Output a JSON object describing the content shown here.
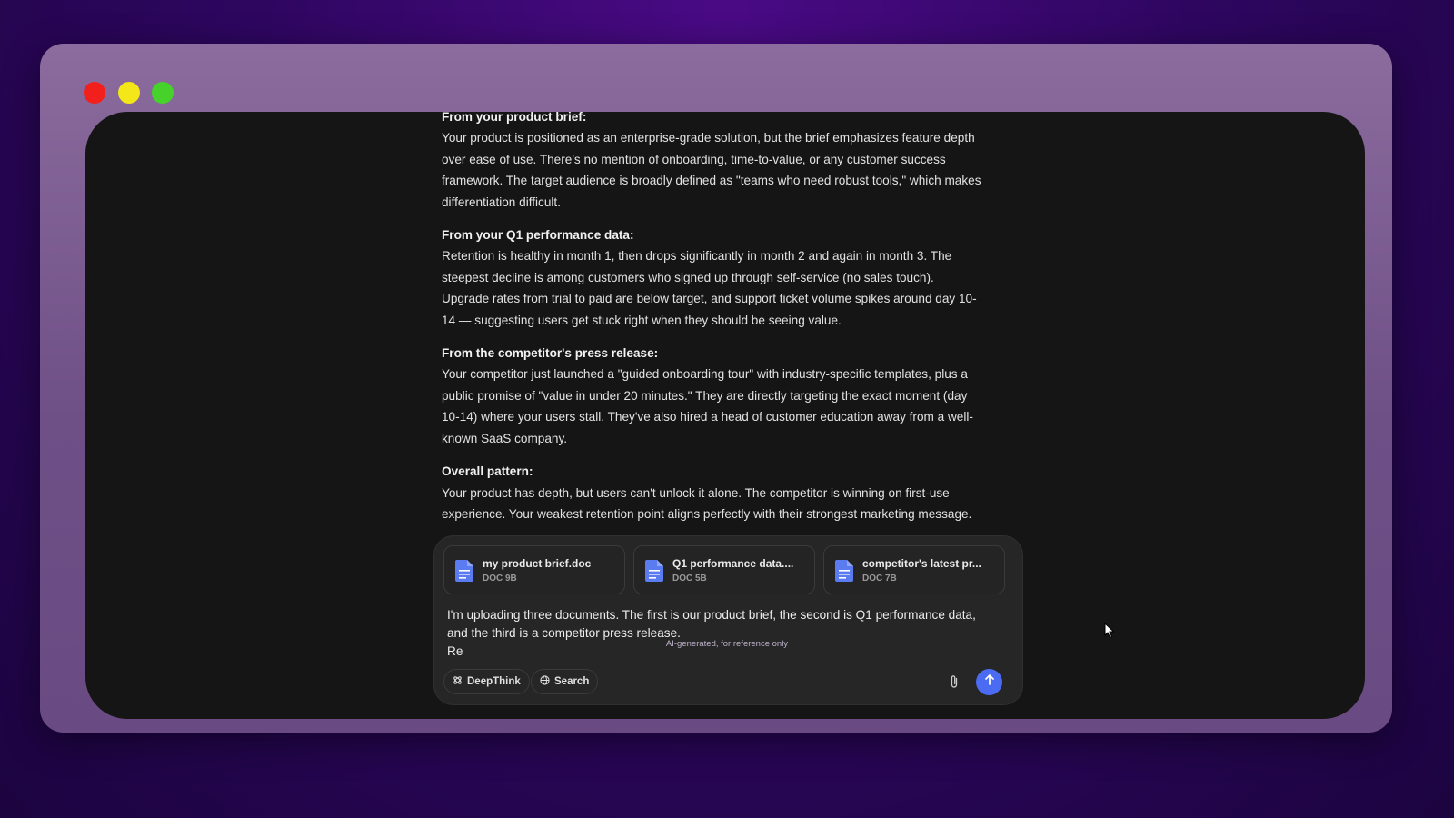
{
  "window": {
    "traffic_lights": [
      "close",
      "minimize",
      "maximize"
    ],
    "colors": {
      "close": "#f2201c",
      "minimize": "#f3e71a",
      "maximize": "#46d12b"
    }
  },
  "chat": {
    "sections": [
      {
        "title": "From your product brief:",
        "lines": [
          "Your product is positioned as an enterprise-grade solution, but the brief emphasizes feature depth",
          "over ease of use. There's no mention of onboarding, time-to-value, or any customer success",
          "framework. The target audience is broadly defined as \"teams who need robust tools,\" which makes",
          "differentiation difficult."
        ]
      },
      {
        "title": "From your Q1 performance data:",
        "lines": [
          "Retention is healthy in month 1, then drops significantly in month 2 and again in month 3. The",
          "steepest decline is among customers who signed up through self-service (no sales touch).",
          "Upgrade rates from trial to paid are below target, and support ticket volume spikes around day 10-",
          "14 — suggesting users get stuck right when they should be seeing value."
        ]
      },
      {
        "title": "From the competitor's press release:",
        "lines": [
          "Your competitor just launched a \"guided onboarding tour\" with industry-specific templates, plus a",
          "public promise of \"value in under 20 minutes.\" They are directly targeting the exact moment (day",
          "10-14) where your users stall. They've also hired a head of customer education away from a well-",
          "known SaaS company."
        ]
      },
      {
        "title": "Overall pattern:",
        "lines": [
          "Your product has depth, but users can't unlock it alone. The competitor is winning on first-use",
          "experience. Your weakest retention point aligns perfectly with their strongest marketing message."
        ]
      }
    ]
  },
  "composer": {
    "files": [
      {
        "name": "my product brief.doc",
        "meta": "DOC 9B"
      },
      {
        "name": "Q1 performance data....",
        "meta": "DOC 5B"
      },
      {
        "name": "competitor's latest pr...",
        "meta": "DOC 7B"
      }
    ],
    "message_lines": [
      "I'm uploading three documents. The first is our product brief, the second is Q1 performance data,",
      "and the third is a competitor press release.",
      "Re"
    ],
    "deepthink_label": "DeepThink",
    "search_label": "Search",
    "icons": {
      "attach": "paperclip-icon",
      "send": "arrow-up-icon",
      "file": "document-icon"
    },
    "accent_color": "#4b6bf2",
    "file_icon_color": "#5b7cf0"
  },
  "footer": {
    "disclaimer": "AI-generated, for reference only"
  }
}
